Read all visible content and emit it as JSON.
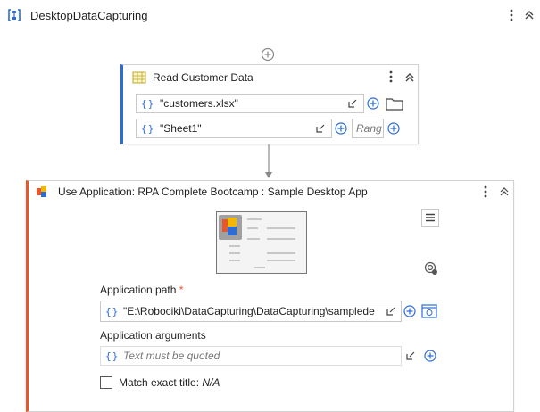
{
  "sequence": {
    "title": "DesktopDataCapturing",
    "icon": "sequence-icon"
  },
  "read_activity": {
    "title": "Read Customer Data",
    "icon": "excel-icon",
    "workbook_value": "\"customers.xlsx\"",
    "sheet_value": "\"Sheet1\"",
    "range_placeholder": "Rang"
  },
  "use_app": {
    "title": "Use Application: RPA Complete Bootcamp : Sample Desktop App",
    "icon": "application-icon",
    "path_label": "Application path",
    "required_marker": "*",
    "path_value": "\"E:\\Robociki\\DataCapturing\\DataCapturing\\samplede",
    "args_label": "Application arguments",
    "args_placeholder": "Text must be quoted",
    "match_label": "Match exact title:",
    "match_value": "N/A"
  },
  "colors": {
    "accent_blue": "#2b6cd6",
    "accent_orange": "#e8562a",
    "border": "#c9c9c9"
  }
}
